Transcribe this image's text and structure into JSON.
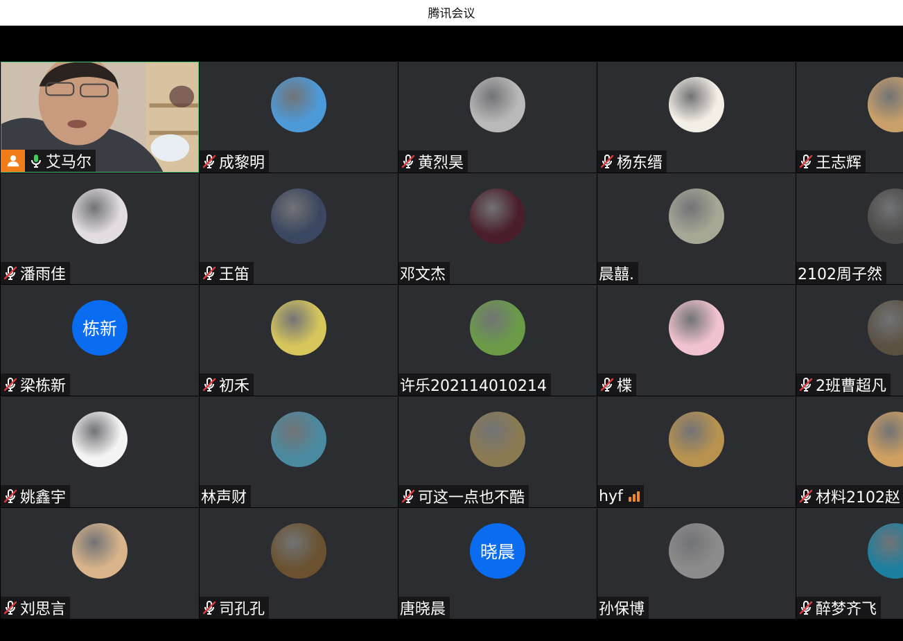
{
  "window": {
    "title": "腾讯会议"
  },
  "participants": [
    {
      "name": "艾马尔",
      "muted": false,
      "self": true
    },
    {
      "name": "成黎明",
      "muted": true,
      "avatar_color": "#4d9ad8"
    },
    {
      "name": "黄烈昊",
      "muted": true,
      "avatar_color": "#b9b9b9"
    },
    {
      "name": "杨东缙",
      "muted": true,
      "avatar_color": "#f4efe6"
    },
    {
      "name": "王志辉",
      "muted": true,
      "avatar_color": "#c9a06a"
    },
    {
      "name": "潘雨佳",
      "muted": true,
      "avatar_color": "#e3dde2"
    },
    {
      "name": "王笛",
      "muted": true,
      "avatar_color": "#3b4760"
    },
    {
      "name": "邓文杰",
      "muted": false,
      "avatar_color": "#4a1d2a"
    },
    {
      "name": "晨囍.",
      "muted": false,
      "avatar_color": "#a7a796"
    },
    {
      "name": "2102周子然",
      "muted": false,
      "avatar_color": "#4a4a48"
    },
    {
      "name": "梁栋新",
      "muted": true,
      "avatar_text": "栋新"
    },
    {
      "name": "初禾",
      "muted": true,
      "avatar_color": "#d7c65c"
    },
    {
      "name": "许乐202114010214",
      "muted": false,
      "avatar_color": "#6a9c48"
    },
    {
      "name": "楪",
      "muted": true,
      "avatar_color": "#f1c3d0"
    },
    {
      "name": "2班曹超凡",
      "muted": true,
      "avatar_color": "#5a5142"
    },
    {
      "name": "姚鑫宇",
      "muted": true,
      "avatar_color": "#f4f4f4"
    },
    {
      "name": "林声财",
      "muted": false,
      "avatar_color": "#4a8aa0"
    },
    {
      "name": "可这一点也不酷",
      "muted": true,
      "avatar_color": "#8a7a52"
    },
    {
      "name": "hyf",
      "muted": false,
      "signal": true,
      "avatar_color": "#b8924f"
    },
    {
      "name": "材料2102赵",
      "muted": true,
      "avatar_color": "#d0a060"
    },
    {
      "name": "刘思言",
      "muted": true,
      "avatar_color": "#d9b48a"
    },
    {
      "name": "司孔孔",
      "muted": true,
      "avatar_color": "#6a5230"
    },
    {
      "name": "唐晓晨",
      "muted": false,
      "avatar_text": "晓晨"
    },
    {
      "name": "孙保博",
      "muted": false,
      "avatar_color": "#8c8c8c"
    },
    {
      "name": "醉梦齐飞",
      "muted": true,
      "avatar_color": "#1d7fa0"
    }
  ]
}
